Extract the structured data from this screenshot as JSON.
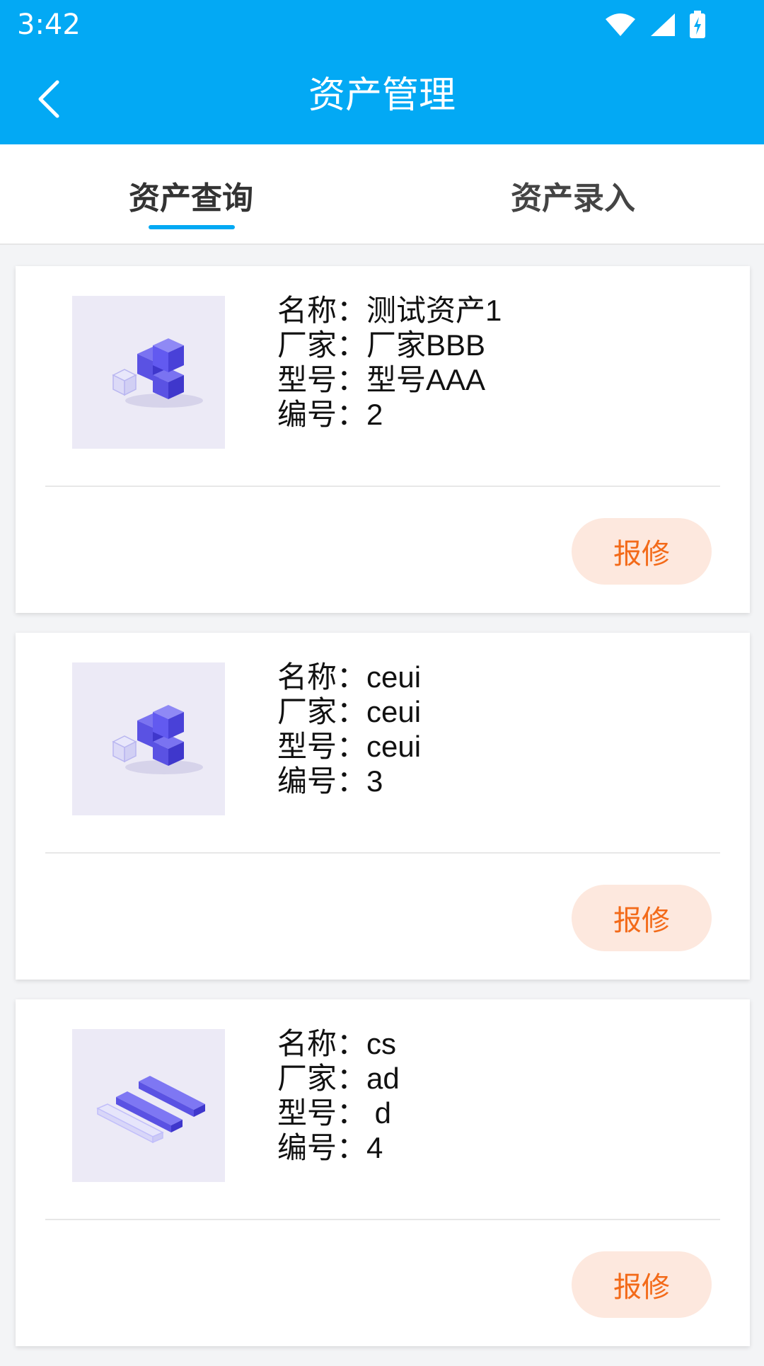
{
  "status_bar": {
    "time": "3:42"
  },
  "header": {
    "title": "资产管理"
  },
  "tabs": [
    {
      "label": "资产查询"
    },
    {
      "label": "资产录入"
    }
  ],
  "labels": {
    "name": "名称：",
    "maker": "厂家：",
    "model": "型号：",
    "code": "编号："
  },
  "assets": [
    {
      "name": "测试资产1",
      "maker": "厂家BBB",
      "model": "型号AAA",
      "code": "2",
      "image": "cubes-image",
      "action": "报修"
    },
    {
      "name": "ceui",
      "maker": "ceui",
      "model": "ceui",
      "code": "3",
      "image": "cubes-image",
      "action": "报修"
    },
    {
      "name": "cs",
      "maker": "ad",
      "model": " d",
      "code": "4",
      "image": "bars-image",
      "action": "报修"
    }
  ],
  "colors": {
    "primary": "#03a9f4",
    "repair_bg": "#fde8de",
    "repair_text": "#f36a19"
  }
}
